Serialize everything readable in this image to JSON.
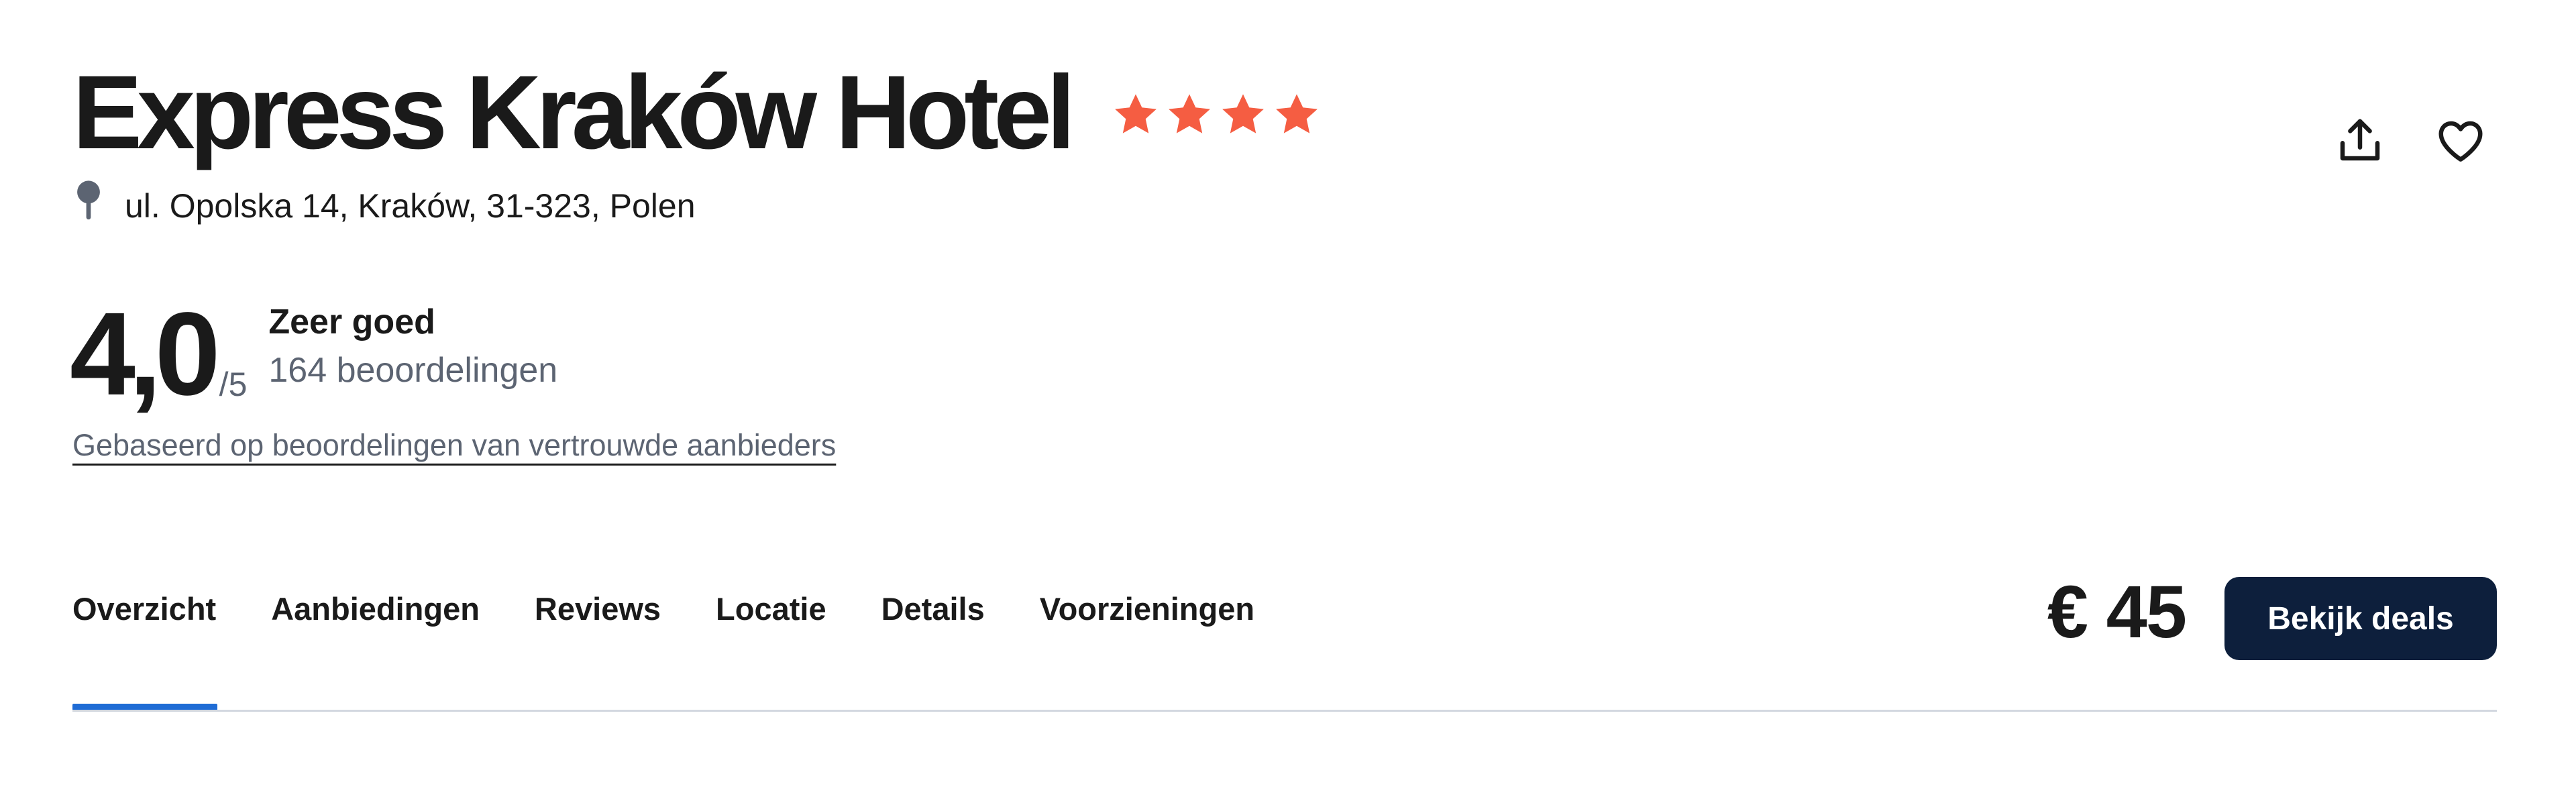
{
  "hotel": {
    "name": "Express Kraków Hotel",
    "stars": 4,
    "address": "ul. Opolska 14, Kraków, 31-323, Polen"
  },
  "rating": {
    "score": "4,0",
    "max": "/5",
    "label": "Zeer goed",
    "reviews": "164 beoordelingen",
    "source_link": "Gebaseerd op beoordelingen van vertrouwde aanbieders"
  },
  "tabs": [
    {
      "label": "Overzicht",
      "active": true
    },
    {
      "label": "Aanbiedingen"
    },
    {
      "label": "Reviews"
    },
    {
      "label": "Locatie"
    },
    {
      "label": "Details"
    },
    {
      "label": "Voorzieningen"
    }
  ],
  "booking": {
    "price": "€ 45",
    "button_label": "Bekijk deals"
  },
  "actions": {
    "share_icon": "share-icon",
    "favorite_icon": "heart-icon"
  },
  "colors": {
    "star": "#f55d42",
    "accent": "#1f6cd5",
    "button_bg": "#0d1f3c",
    "muted_text": "#5c6472"
  }
}
